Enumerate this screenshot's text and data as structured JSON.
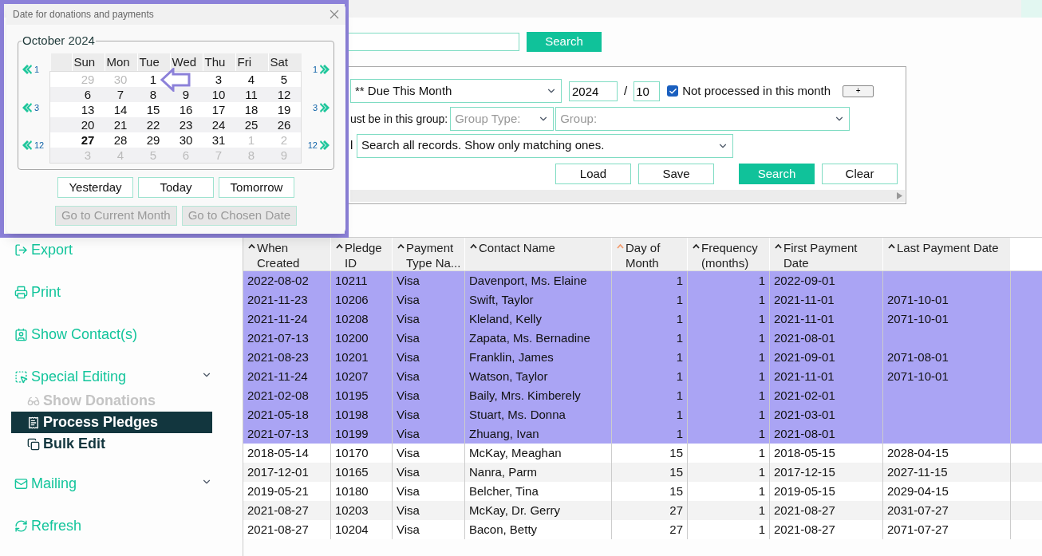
{
  "dialog": {
    "title": "Date for donations and payments",
    "month_label": "October 2024",
    "weekdays": [
      "Sun",
      "Mon",
      "Tue",
      "Wed",
      "Thu",
      "Fri",
      "Sat"
    ],
    "nav": {
      "back": [
        "1",
        "3",
        "12"
      ],
      "forward": [
        "1",
        "3",
        "12"
      ]
    },
    "weeks": [
      [
        {
          "day": "29",
          "muted": true
        },
        {
          "day": "30",
          "muted": true
        },
        {
          "day": "1",
          "muted": false
        },
        {
          "covered": true
        },
        {
          "day": "3",
          "muted": false
        },
        {
          "day": "4",
          "muted": false
        },
        {
          "day": "5",
          "muted": false
        }
      ],
      [
        {
          "day": "6",
          "muted": false
        },
        {
          "day": "7",
          "muted": false
        },
        {
          "day": "8",
          "muted": false
        },
        {
          "day": "9",
          "muted": false
        },
        {
          "day": "10",
          "muted": false
        },
        {
          "day": "11",
          "muted": false
        },
        {
          "day": "12",
          "muted": false
        }
      ],
      [
        {
          "day": "13",
          "muted": false
        },
        {
          "day": "14",
          "muted": false
        },
        {
          "day": "15",
          "muted": false
        },
        {
          "day": "16",
          "muted": false
        },
        {
          "day": "17",
          "muted": false
        },
        {
          "day": "18",
          "muted": false
        },
        {
          "day": "19",
          "muted": false
        }
      ],
      [
        {
          "day": "20",
          "muted": false
        },
        {
          "day": "21",
          "muted": false
        },
        {
          "day": "22",
          "muted": false
        },
        {
          "day": "23",
          "muted": false
        },
        {
          "day": "24",
          "muted": false
        },
        {
          "day": "25",
          "muted": false
        },
        {
          "day": "26",
          "muted": false
        }
      ],
      [
        {
          "day": "27",
          "muted": false,
          "today": true
        },
        {
          "day": "28",
          "muted": false
        },
        {
          "day": "29",
          "muted": false
        },
        {
          "day": "30",
          "muted": false
        },
        {
          "day": "31",
          "muted": false
        },
        {
          "day": "1",
          "muted": true
        },
        {
          "day": "2",
          "muted": true
        }
      ],
      [
        {
          "day": "3",
          "muted": true
        },
        {
          "day": "4",
          "muted": true
        },
        {
          "day": "5",
          "muted": true
        },
        {
          "day": "6",
          "muted": true
        },
        {
          "day": "7",
          "muted": true
        },
        {
          "day": "8",
          "muted": true
        },
        {
          "day": "9",
          "muted": true
        }
      ]
    ],
    "quick_buttons": [
      {
        "label": "Yesterday",
        "disabled": false
      },
      {
        "label": "Today",
        "disabled": false
      },
      {
        "label": "Tomorrow",
        "disabled": false
      }
    ],
    "goto_buttons": [
      {
        "label": "Go to Current Month",
        "disabled": true
      },
      {
        "label": "Go to Chosen Date",
        "disabled": true
      }
    ]
  },
  "search": {
    "button": "Search"
  },
  "filter": {
    "preset": "** Due This Month",
    "year": "2024",
    "separator": "/",
    "month": "10",
    "not_processed": {
      "label": "Not processed in this month",
      "checked": true
    },
    "plus_button": "+",
    "group_label": "ust be in this group:",
    "group_type": {
      "placeholder": "Group Type:"
    },
    "group": {
      "placeholder": "Group:"
    },
    "scope_label": "l",
    "scope": "Search all records. Show only matching ones.",
    "buttons": [
      {
        "label": "Load",
        "primary": false
      },
      {
        "label": "Save",
        "primary": false
      },
      {
        "label": "Search",
        "primary": true
      },
      {
        "label": "Clear",
        "primary": false
      }
    ]
  },
  "sidebar": {
    "items": [
      {
        "label": "Export",
        "has_menu": false
      },
      {
        "label": "Print",
        "has_menu": false
      },
      {
        "label": "Show Contact(s)",
        "has_menu": false
      },
      {
        "label": "Special Editing",
        "has_menu": true,
        "children": [
          {
            "label": "Show Donations",
            "disabled": true,
            "selected": false
          },
          {
            "label": "Process Pledges",
            "disabled": false,
            "selected": true
          },
          {
            "label": "Bulk Edit",
            "disabled": false,
            "selected": false
          }
        ]
      },
      {
        "label": "Mailing",
        "has_menu": true
      },
      {
        "label": "Refresh",
        "has_menu": false
      }
    ]
  },
  "table": {
    "columns": [
      {
        "label": "When Created",
        "sort_active": false,
        "kind": "text"
      },
      {
        "label": "Pledge ID",
        "sort_active": false,
        "kind": "text"
      },
      {
        "label": "Payment Type Na...",
        "sort_active": false,
        "kind": "text"
      },
      {
        "label": "Contact Name",
        "sort_active": false,
        "kind": "text"
      },
      {
        "label": "Day of Month",
        "sort_active": true,
        "kind": "number"
      },
      {
        "label": "Frequency (months)",
        "sort_active": false,
        "kind": "number"
      },
      {
        "label": "First Payment Date",
        "sort_active": false,
        "kind": "text"
      },
      {
        "label": "Last Payment Date",
        "sort_active": false,
        "kind": "text"
      }
    ],
    "rows": [
      {
        "selected": true,
        "cells": [
          "2022-08-02",
          "10211",
          "Visa",
          "Davenport, Ms. Elaine",
          "1",
          "1",
          "2022-09-01"
        ]
      },
      {
        "selected": true,
        "cells": [
          "2021-11-23",
          "10206",
          "Visa",
          "Swift, Taylor",
          "1",
          "1",
          "2021-11-01",
          "2071-10-01"
        ]
      },
      {
        "selected": true,
        "cells": [
          "2021-11-24",
          "10208",
          "Visa",
          "Kleland, Kelly",
          "1",
          "1",
          "2021-11-01",
          "2071-10-01"
        ]
      },
      {
        "selected": true,
        "cells": [
          "2021-07-13",
          "10200",
          "Visa",
          "Zapata, Ms. Bernadine",
          "1",
          "1",
          "2021-08-01"
        ]
      },
      {
        "selected": true,
        "cells": [
          "2021-08-23",
          "10201",
          "Visa",
          "Franklin, James",
          "1",
          "1",
          "2021-09-01",
          "2071-08-01"
        ]
      },
      {
        "selected": true,
        "cells": [
          "2021-11-24",
          "10207",
          "Visa",
          "Watson, Taylor",
          "1",
          "1",
          "2021-11-01",
          "2071-10-01"
        ]
      },
      {
        "selected": true,
        "cells": [
          "2021-02-08",
          "10195",
          "Visa",
          "Baily, Mrs. Kimberely",
          "1",
          "1",
          "2021-02-01"
        ]
      },
      {
        "selected": true,
        "cells": [
          "2021-05-18",
          "10198",
          "Visa",
          "Stuart, Ms. Donna",
          "1",
          "1",
          "2021-03-01"
        ]
      },
      {
        "selected": true,
        "cells": [
          "2021-07-13",
          "10199",
          "Visa",
          "Zhuang, Ivan",
          "1",
          "1",
          "2021-08-01"
        ]
      },
      {
        "selected": false,
        "cells": [
          "2018-05-14",
          "10170",
          "Visa",
          "McKay, Meaghan",
          "15",
          "1",
          "2018-05-15",
          "2028-04-15"
        ]
      },
      {
        "selected": false,
        "cells": [
          "2017-12-01",
          "10165",
          "Visa",
          "Nanra, Parm",
          "15",
          "1",
          "2017-12-15",
          "2027-11-15"
        ]
      },
      {
        "selected": false,
        "cells": [
          "2019-05-21",
          "10180",
          "Visa",
          "Belcher, Tina",
          "15",
          "1",
          "2019-05-15",
          "2029-04-15"
        ]
      },
      {
        "selected": false,
        "cells": [
          "2021-08-27",
          "10203",
          "Visa",
          "McKay, Dr. Gerry",
          "27",
          "1",
          "2021-08-27",
          "2031-07-27"
        ]
      },
      {
        "selected": false,
        "cells": [
          "2021-08-27",
          "10204",
          "Visa",
          "Bacon, Betty",
          "27",
          "1",
          "2021-08-27",
          "2071-07-27"
        ]
      }
    ]
  }
}
